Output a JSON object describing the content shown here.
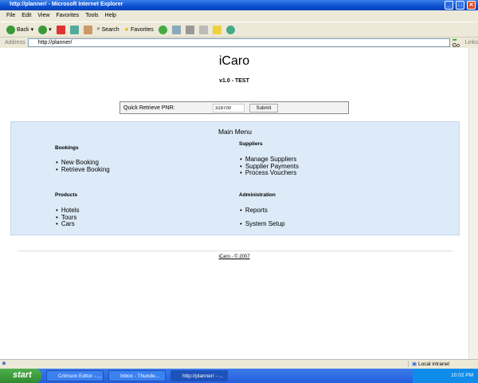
{
  "window": {
    "title": "http://planner/ - Microsoft Internet Explorer"
  },
  "menubar": [
    "File",
    "Edit",
    "View",
    "Favorites",
    "Tools",
    "Help"
  ],
  "toolbar": {
    "back": "Back",
    "search": "Search",
    "favorites": "Favorites"
  },
  "address": {
    "label": "Address",
    "url": "http://planner/",
    "go": "Go",
    "links": "Links"
  },
  "page": {
    "title": "iCaro",
    "version": "v1.0 - TEST",
    "pnr": {
      "label": "Quick Retrieve PNR:",
      "value": "319700",
      "submit": "Submit"
    },
    "menu": {
      "title": "Main Menu",
      "bookings": {
        "heading": "Bookings",
        "items": [
          "New Booking",
          "Retrieve Booking"
        ]
      },
      "products": {
        "heading": "Products",
        "items": [
          "Hotels",
          "Tours",
          "Cars"
        ]
      },
      "suppliers": {
        "heading": "Suppliers",
        "items": [
          "Manage Suppliers",
          "Supplier Payments",
          "Process Vouchers"
        ]
      },
      "administration": {
        "heading": "Administration",
        "items": [
          "Reports",
          "System Setup"
        ]
      }
    },
    "footer": "iCaro - © 2007"
  },
  "status": {
    "zone": "Local intranet"
  },
  "taskbar": {
    "start": "start",
    "tasks": [
      "Crimson Editor - ...",
      "Inbox - Thunde...",
      "http://planner/ - ..."
    ],
    "clock": "10:02 PM"
  }
}
